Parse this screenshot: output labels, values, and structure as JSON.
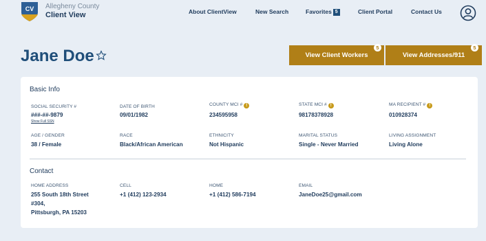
{
  "header": {
    "county": "Allegheny County",
    "app_name": "Client View",
    "logo_text": "CV",
    "nav": {
      "about": "About ClientView",
      "new_search": "New Search",
      "favorites": "Favorites",
      "favorites_count": "5",
      "client_portal": "Client Portal",
      "contact_us": "Contact Us"
    }
  },
  "client": {
    "name": "Jane Doe"
  },
  "actions": {
    "view_workers": "View Client Workers",
    "workers_count": "5",
    "view_addresses": "View Addresses/911",
    "addresses_count": "5"
  },
  "basic_info": {
    "title": "Basic Info",
    "ssn_label": "Social Security #",
    "ssn_value": "###-##-9879",
    "ssn_link": "Show Full SSN",
    "dob_label": "Date of Birth",
    "dob_value": "09/01/1982",
    "county_mci_label": "County MCI #",
    "county_mci_value": "234595958",
    "state_mci_label": "State MCI #",
    "state_mci_value": "98178378928",
    "ma_label": "MA Recipient #",
    "ma_value": "010928374",
    "age_gender_label": "Age / Gender",
    "age_gender_value": "38 / Female",
    "race_label": "Race",
    "race_value": "Black/African American",
    "ethnicity_label": "Ethnicity",
    "ethnicity_value": "Not Hispanic",
    "marital_label": "Marital Status",
    "marital_value": "Single - Never Married",
    "living_label": "Living Assignment",
    "living_value": "Living Alone"
  },
  "contact": {
    "title": "Contact",
    "home_address_label": "Home Address",
    "home_address_line1": "255 South 18th Street",
    "home_address_line2": "#304,",
    "home_address_line3": "Pittsburgh, PA 15203",
    "cell_label": "Cell",
    "cell_value": "+1 (412) 123-2934",
    "home_label": "Home",
    "home_value": "+1 (412) 586-7194",
    "email_label": "Email",
    "email_value": "JaneDoe25@gmail.com"
  },
  "colors": {
    "primary": "#1f4e79",
    "accent": "#b07f17",
    "background": "#e8eef5"
  },
  "icons": {
    "logo": "shield-logo-icon",
    "user": "user-circle-icon",
    "favorite": "star-outline-icon",
    "info": "info-icon"
  }
}
